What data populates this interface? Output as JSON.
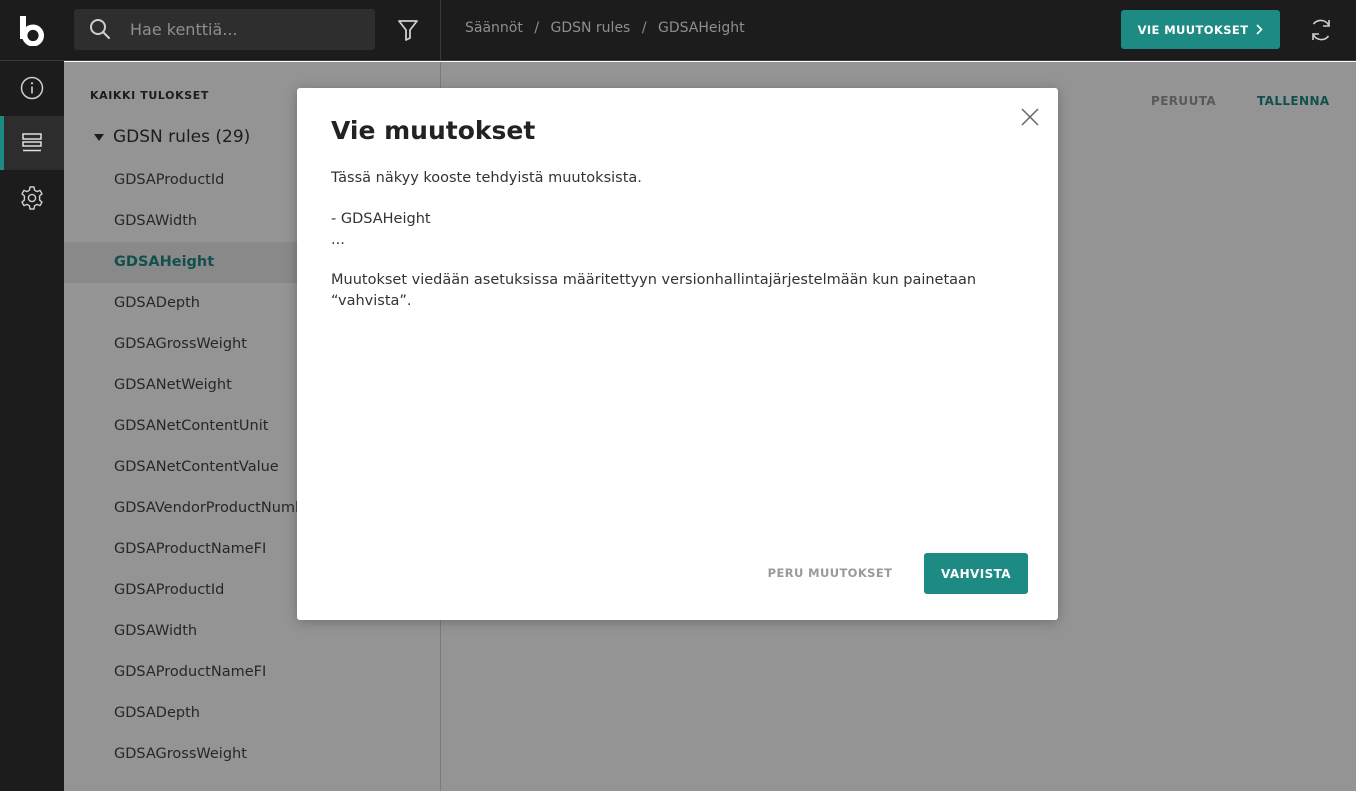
{
  "colors": {
    "accent": "#1e8a84",
    "topbar": "#1c1c1c",
    "overlay": "rgba(0,0,0,0.42)"
  },
  "header": {
    "logo_icon": "brand-b-logo",
    "search": {
      "icon": "search-icon",
      "placeholder": "Hae kenttiä...",
      "value": ""
    },
    "filter_icon": "filter-icon",
    "breadcrumb": [
      "Säännöt",
      "GDSN rules",
      "GDSAHeight"
    ],
    "export_label": "VIE MUUTOKSET",
    "export_icon": "chevron-right-icon",
    "refresh_icon": "refresh-icon"
  },
  "rail": {
    "items": [
      {
        "name": "info",
        "icon": "info-icon",
        "active": false
      },
      {
        "name": "rules",
        "icon": "rules-icon",
        "active": true
      },
      {
        "name": "settings",
        "icon": "gear-icon",
        "active": false
      }
    ]
  },
  "results": {
    "heading": "KAIKKI TULOKSET",
    "group": {
      "label": "GDSN rules (29)",
      "expanded": true
    },
    "items": [
      "GDSAProductId",
      "GDSAWidth",
      "GDSAHeight",
      "GDSADepth",
      "GDSAGrossWeight",
      "GDSANetWeight",
      "GDSANetContentUnit",
      "GDSANetContentValue",
      "GDSAVendorProductNumb",
      "GDSAProductNameFI",
      "GDSAProductId",
      "GDSAWidth",
      "GDSAProductNameFI",
      "GDSADepth",
      "GDSAGrossWeight"
    ],
    "selected_index": 2
  },
  "main": {
    "cancel_label": "PERUUTA",
    "save_label": "TALLENNA"
  },
  "modal": {
    "title": "Vie muutokset",
    "intro": "Tässä näkyy kooste tehdyistä muutoksista.",
    "changes": [
      "- GDSAHeight",
      "..."
    ],
    "note": "Muutokset viedään asetuksissa määritettyyn versionhallintajärjestelmään kun painetaan “vahvista”.",
    "discard_label": "PERU MUUTOKSET",
    "confirm_label": "VAHVISTA",
    "close_icon": "close-icon"
  }
}
